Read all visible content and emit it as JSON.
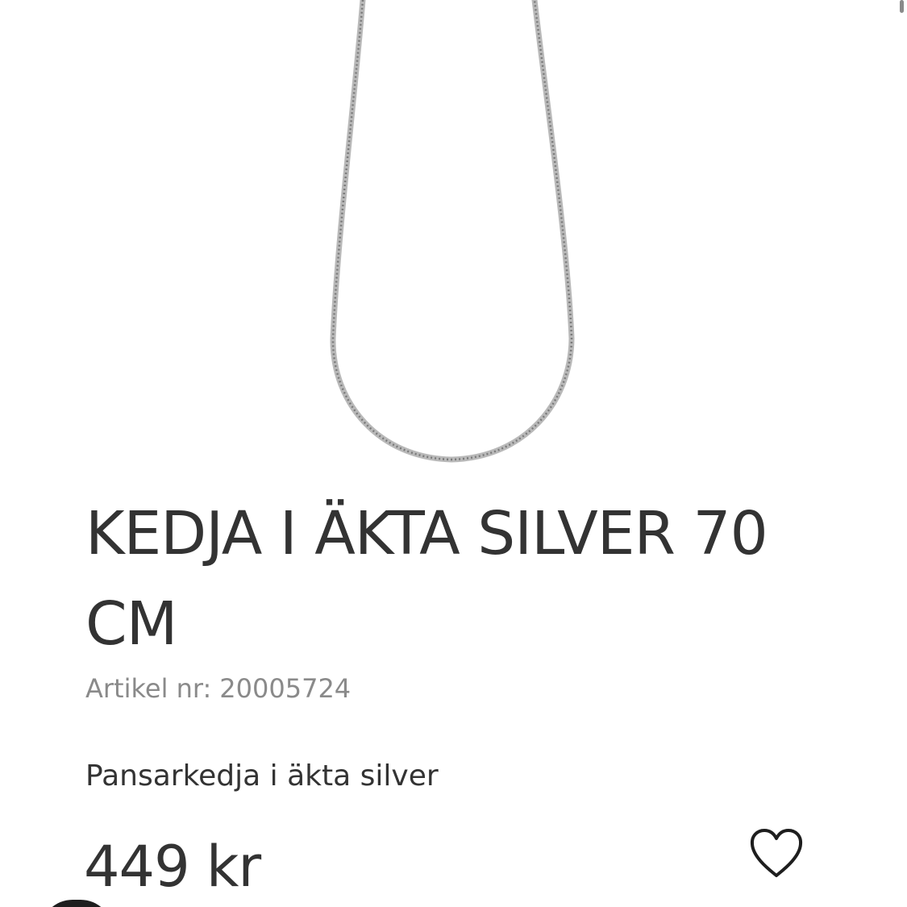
{
  "product": {
    "title": "KEDJA I ÄKTA SILVER 70 CM",
    "article_label": "Artikel nr:",
    "article_number": "20005724",
    "description": "Pansarkedja i äkta silver",
    "price": "449 kr"
  },
  "icons": {
    "wishlist": "heart-outline-icon"
  },
  "colors": {
    "text": "#333333",
    "muted_text": "#8a8a8a",
    "chain": "#b9b9b9",
    "background": "#ffffff"
  }
}
